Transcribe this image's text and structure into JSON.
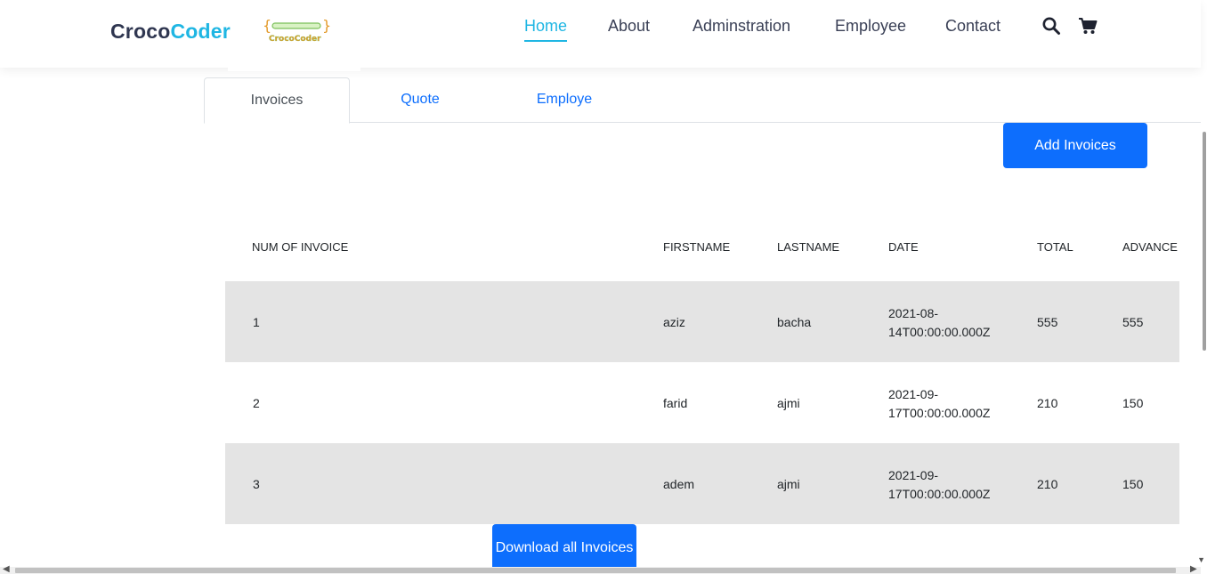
{
  "brand": {
    "part1": "Croco",
    "part2": "Coder",
    "logo_text": "CrocoCoder"
  },
  "nav": {
    "home": "Home",
    "about": "About",
    "administration": "Adminstration",
    "employee": "Employee",
    "contact": "Contact"
  },
  "tabs": {
    "invoices": "Invoices",
    "quote": "Quote",
    "employe": "Employe"
  },
  "buttons": {
    "add_invoices": "Add Invoices",
    "download_all": "Download all Invoices"
  },
  "table": {
    "headers": {
      "num": "NUM OF INVOICE",
      "firstname": "FIRSTNAME",
      "lastname": "LASTNAME",
      "date": "DATE",
      "total": "TOTAL",
      "advance": "ADVANCE"
    },
    "rows": [
      {
        "num": "1",
        "firstname": "aziz",
        "lastname": "bacha",
        "date_line1": "2021-08-",
        "date_line2": "14T00:00:00.000Z",
        "total": "555",
        "advance": "555"
      },
      {
        "num": "2",
        "firstname": "farid",
        "lastname": "ajmi",
        "date_line1": "2021-09-",
        "date_line2": "17T00:00:00.000Z",
        "total": "210",
        "advance": "150"
      },
      {
        "num": "3",
        "firstname": "adem",
        "lastname": "ajmi",
        "date_line1": "2021-09-",
        "date_line2": "17T00:00:00.000Z",
        "total": "210",
        "advance": "150"
      }
    ]
  },
  "colors": {
    "brand_dark": "#2f3650",
    "brand_accent": "#1fb6e3",
    "primary_button": "#0d6efd",
    "row_shade": "#e4e4e4"
  },
  "icons": {
    "search": "search-icon",
    "cart": "cart-icon"
  }
}
